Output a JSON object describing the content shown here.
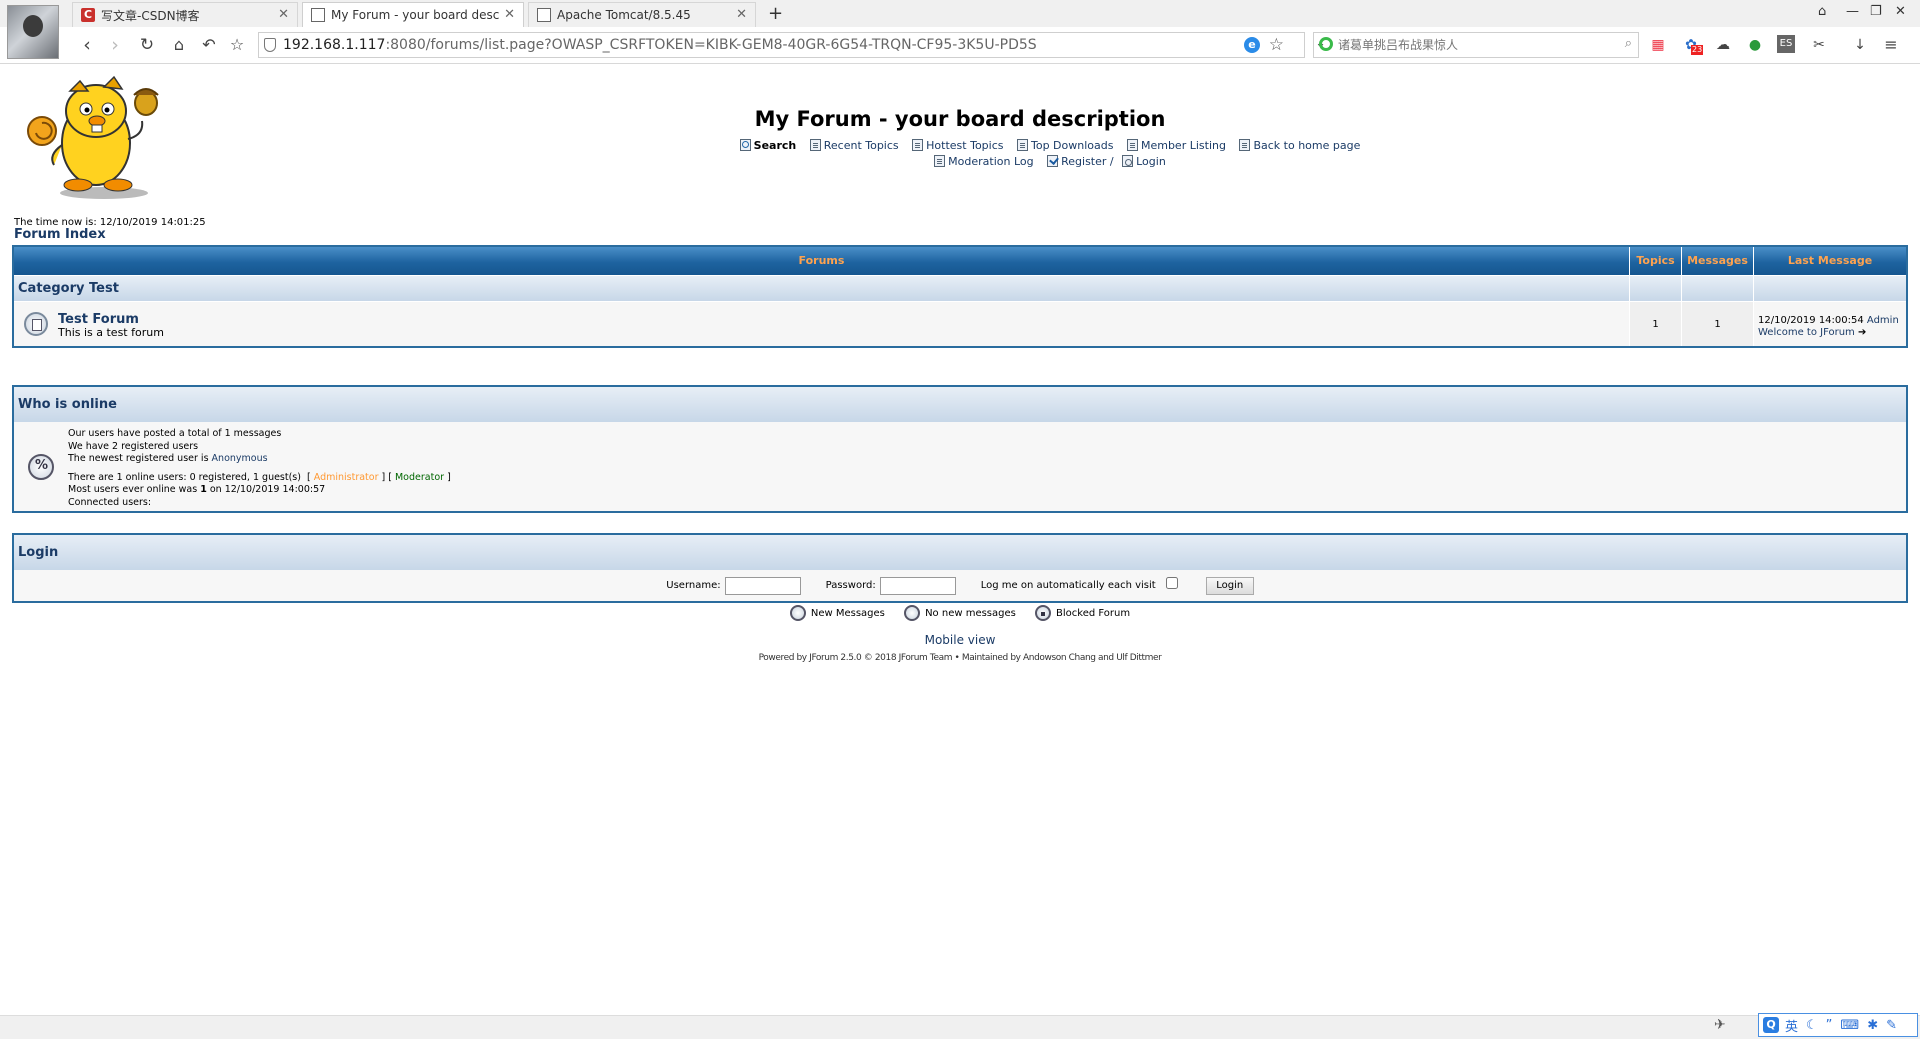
{
  "browser": {
    "tabs": [
      {
        "title": "写文章-CSDN博客",
        "favicon": "C"
      },
      {
        "title": "My Forum - your board desc",
        "active": true
      },
      {
        "title": "Apache Tomcat/8.5.45"
      }
    ],
    "new_tab": "+",
    "window_controls": [
      "⌂",
      "—",
      "❐",
      "✕"
    ],
    "url_host": "192.168.1.117",
    "url_rest": ":8080/forums/list.page?OWASP_CSRFTOKEN=KIBK-GEM8-40GR-6G54-TRQN-CF95-3K5U-PD5S",
    "search_placeholder": "诸葛单挑吕布战果惊人",
    "ie_badge": "e",
    "ext_badge": "23",
    "es_label": "ES"
  },
  "header": {
    "title": "My Forum - your board description",
    "nav": {
      "search": "Search",
      "recent": "Recent Topics",
      "hottest": "Hottest Topics",
      "downloads": "Top Downloads",
      "members": "Member Listing",
      "home": "Back to home page",
      "modlog": "Moderation Log",
      "register": "Register /",
      "login": "Login"
    },
    "time_now": "The time now is: 12/10/2019 14:01:25",
    "forum_index": "Forum Index"
  },
  "forums_table": {
    "headers": {
      "forums": "Forums",
      "topics": "Topics",
      "messages": "Messages",
      "last": "Last Message"
    },
    "category": "Category Test",
    "forum": {
      "name": "Test Forum",
      "description": "This is a test forum",
      "topics": "1",
      "messages": "1",
      "last_date": "12/10/2019 14:00:54",
      "last_user": "Admin",
      "last_topic": "Welcome to JForum"
    }
  },
  "who_online": {
    "title": "Who is online",
    "line1": "Our users have posted a total of 1 messages",
    "line2": "We have 2 registered users",
    "line3_prefix": "The newest registered user is",
    "newest_user": "Anonymous",
    "line4": "There are 1 online users: 0 registered, 1 guest(s)",
    "admin_label": "Administrator",
    "mod_label": "Moderator",
    "line5_prefix": "Most users ever online was",
    "line5_count": "1",
    "line5_suffix": "on 12/10/2019 14:00:57",
    "line6": "Connected users:"
  },
  "login": {
    "title": "Login",
    "username_label": "Username:",
    "password_label": "Password:",
    "auto_label": "Log me on automatically each visit",
    "button": "Login"
  },
  "legend": {
    "new_messages": "New Messages",
    "no_new": "No new messages",
    "blocked": "Blocked Forum"
  },
  "footer": {
    "mobile_view": "Mobile view",
    "powered": "Powered by JForum 2.5.0 © 2018 JForum Team • Maintained by Andowson Chang and Ulf Dittmer"
  },
  "ime": {
    "badge": "Q",
    "lang": "英"
  }
}
